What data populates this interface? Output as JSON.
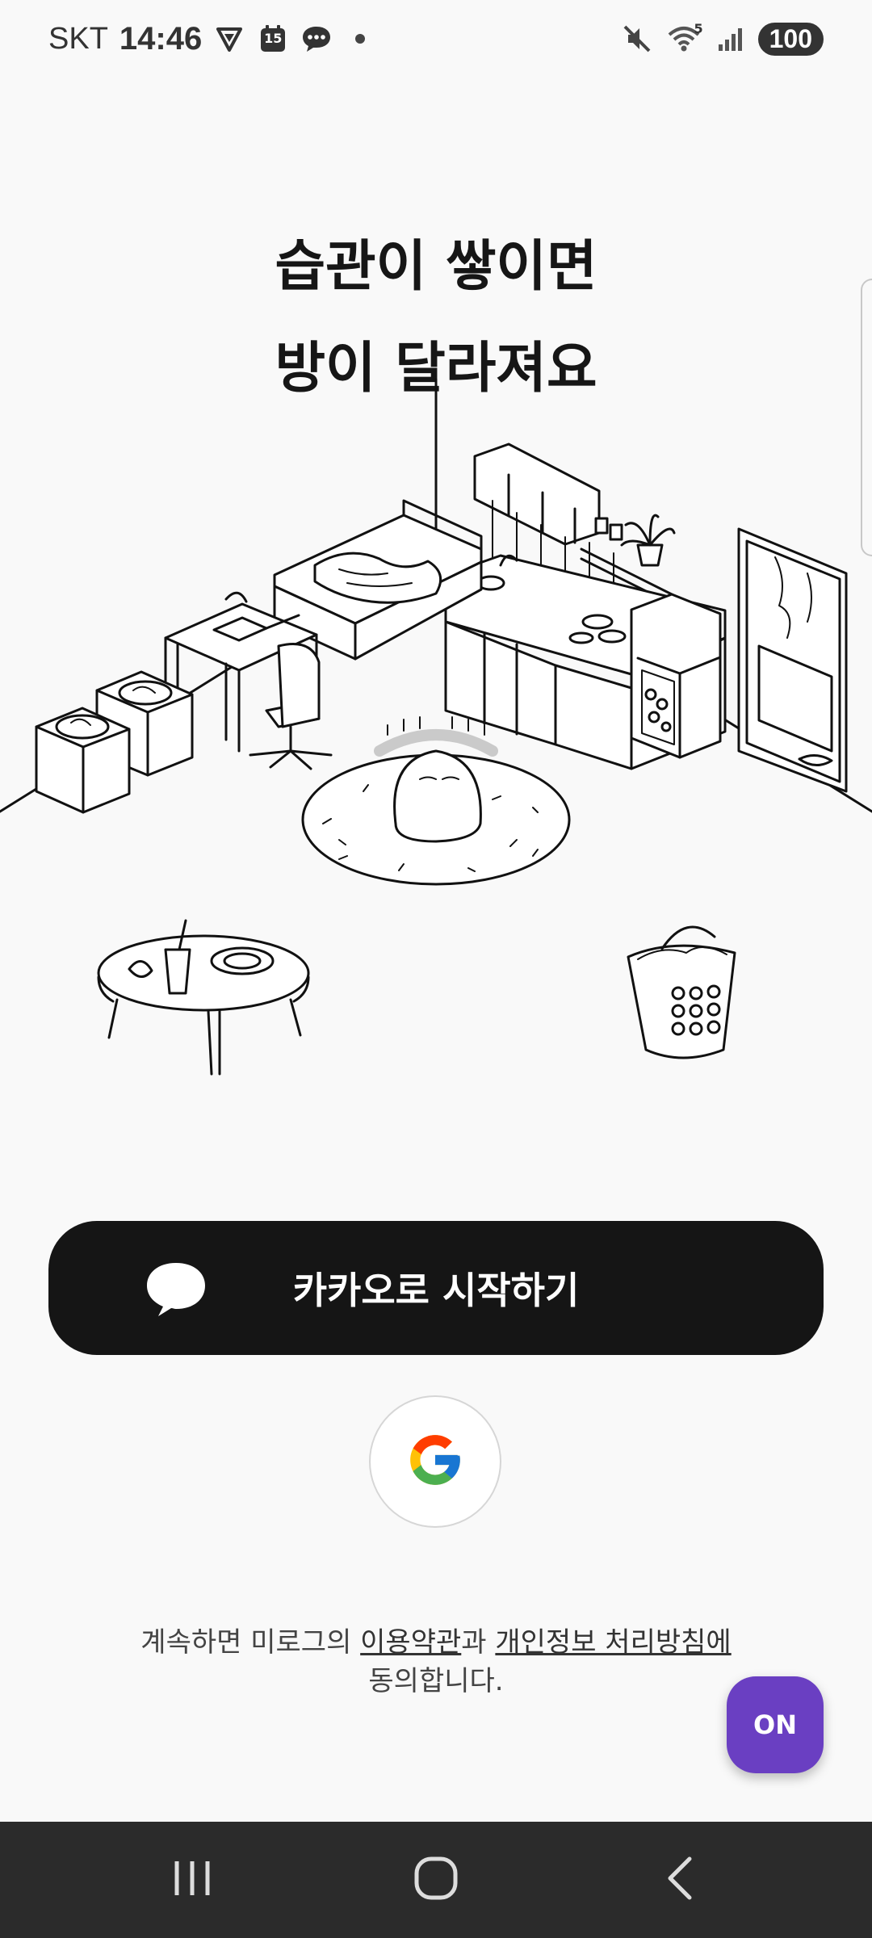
{
  "status_bar": {
    "carrier": "SKT",
    "time": "14:46",
    "calendar_day": "15",
    "battery": "100",
    "wifi_badge": "5"
  },
  "headline": {
    "line1": "습관이 쌓이면",
    "line2": "방이 달라져요"
  },
  "buttons": {
    "kakao_label": "카카오로 시작하기",
    "on_label": "ON"
  },
  "terms": {
    "prefix": "계속하면 미로그의 ",
    "link_terms": "이용약관",
    "mid": "과 ",
    "link_privacy": "개인정보 처리방침에",
    "suffix": "동의합니다."
  },
  "colors": {
    "background": "#f9f9f9",
    "kakao_button": "#151515",
    "on_button": "#6a3fc2",
    "nav_bar": "#2b2b2b"
  },
  "icons": {
    "kakao": "speech-bubble-icon",
    "google": "google-g-icon",
    "nav_recents": "recents-icon",
    "nav_home": "home-icon",
    "nav_back": "back-icon"
  }
}
